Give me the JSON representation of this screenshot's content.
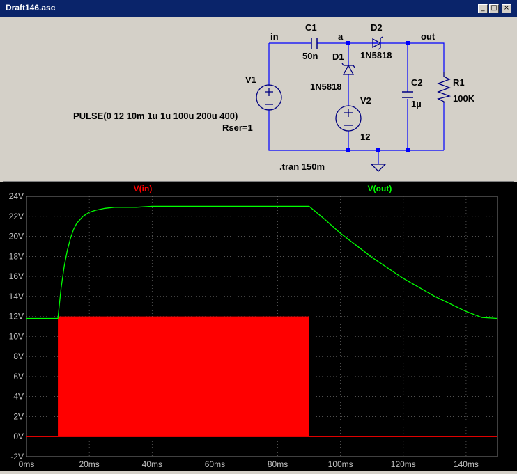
{
  "window": {
    "title": "Draft146.asc",
    "buttons": [
      "_",
      "□",
      "×"
    ]
  },
  "schematic": {
    "labels": {
      "in": "in",
      "a": "a",
      "out": "out",
      "c1": "C1",
      "c1_val": "50n",
      "d2": "D2",
      "d2_val": "1N5818",
      "d1": "D1",
      "d1_val": "1N5818",
      "v1": "V1",
      "v1_val": "PULSE(0 12 10m 1u 1u 100u 200u 400)",
      "v1_rser": "Rser=1",
      "v2": "V2",
      "v2_val": "12",
      "c2": "C2",
      "c2_val": "1µ",
      "r1": "R1",
      "r1_val": "100K",
      "tran": ".tran 150m"
    },
    "wire_color": "#0000ff",
    "component_color": "#000080",
    "node_color": "#0000ff"
  },
  "plot": {
    "trace_labels": {
      "vin": "V(in)",
      "vout": "V(out)"
    },
    "colors": {
      "vin": "#ff0000",
      "vout": "#00ff00",
      "grid": "#808080",
      "axis_text": "#c0c0c0"
    }
  },
  "chart_data": {
    "type": "line",
    "title": "",
    "xlabel": "",
    "ylabel": "",
    "xlim": [
      0,
      150
    ],
    "ylim": [
      -2,
      24
    ],
    "x_unit": "ms",
    "y_unit": "V",
    "xticks": [
      "0ms",
      "20ms",
      "40ms",
      "60ms",
      "80ms",
      "100ms",
      "120ms",
      "140ms"
    ],
    "yticks": [
      "-2V",
      "0V",
      "2V",
      "4V",
      "6V",
      "8V",
      "10V",
      "12V",
      "14V",
      "16V",
      "18V",
      "20V",
      "22V",
      "24V"
    ],
    "grid": true,
    "series": [
      {
        "name": "V(in)",
        "kind": "pulse-envelope",
        "x_start": 10,
        "x_end": 90,
        "low": 0,
        "high": 12
      },
      {
        "name": "V(out)",
        "x": [
          0,
          10,
          11,
          12,
          13,
          14,
          15,
          16,
          18,
          20,
          22,
          25,
          28,
          30,
          35,
          40,
          60,
          80,
          90,
          95,
          100,
          110,
          120,
          130,
          140,
          145,
          150
        ],
        "y": [
          11.8,
          11.8,
          14.8,
          17.0,
          18.6,
          19.8,
          20.7,
          21.3,
          22.0,
          22.4,
          22.6,
          22.8,
          22.9,
          22.9,
          22.9,
          23.0,
          23.0,
          23.0,
          23.0,
          21.7,
          20.3,
          17.9,
          15.8,
          14.0,
          12.5,
          11.9,
          11.8
        ]
      }
    ]
  }
}
